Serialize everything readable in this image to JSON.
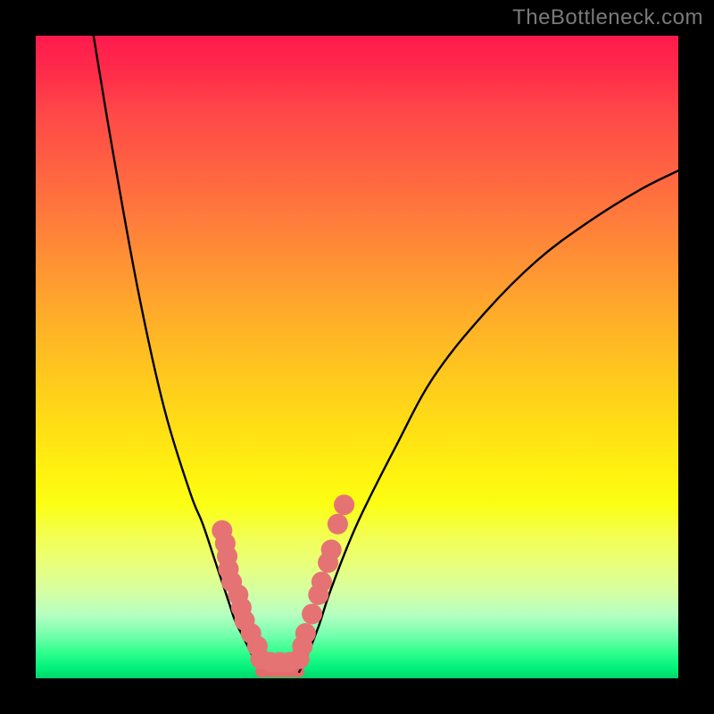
{
  "watermark": "TheBottleneck.com",
  "chart_data": {
    "type": "line",
    "title": "",
    "xlabel": "",
    "ylabel": "",
    "xlim": [
      0,
      100
    ],
    "ylim": [
      0,
      100
    ],
    "legend": false,
    "grid": false,
    "background_gradient": {
      "top": "#ff1a4d",
      "mid": "#ffe016",
      "bottom": "#00d46b"
    },
    "series": [
      {
        "name": "curve-left",
        "color": "#000000",
        "x": [
          9,
          12,
          16,
          20,
          24,
          26,
          28,
          30,
          31,
          32,
          33,
          34,
          35,
          36
        ],
        "values": [
          100,
          82,
          60,
          42,
          29,
          24,
          18,
          12,
          9,
          7,
          5,
          3,
          2,
          1
        ]
      },
      {
        "name": "curve-bottom",
        "color": "#e56a6a",
        "x": [
          35,
          36,
          37,
          38,
          39,
          40,
          41
        ],
        "values": [
          1,
          1,
          1,
          1,
          1,
          1,
          1
        ]
      },
      {
        "name": "curve-right",
        "color": "#000000",
        "x": [
          41,
          42,
          44,
          46,
          50,
          56,
          62,
          70,
          78,
          86,
          94,
          100
        ],
        "values": [
          1,
          3,
          8,
          14,
          24,
          36,
          47,
          57,
          65,
          71,
          76,
          79
        ]
      }
    ],
    "markers": {
      "color": "#e57373",
      "radius": 1.6,
      "points": [
        {
          "x": 29.0,
          "y": 77
        },
        {
          "x": 29.5,
          "y": 79
        },
        {
          "x": 29.8,
          "y": 81
        },
        {
          "x": 30.0,
          "y": 83
        },
        {
          "x": 30.5,
          "y": 85
        },
        {
          "x": 31.5,
          "y": 87
        },
        {
          "x": 32.0,
          "y": 89
        },
        {
          "x": 32.5,
          "y": 91
        },
        {
          "x": 33.5,
          "y": 93
        },
        {
          "x": 34.5,
          "y": 95
        },
        {
          "x": 35.0,
          "y": 97
        },
        {
          "x": 36.5,
          "y": 97.5
        },
        {
          "x": 38.0,
          "y": 97.5
        },
        {
          "x": 39.5,
          "y": 97.5
        },
        {
          "x": 41.0,
          "y": 97.0
        },
        {
          "x": 41.5,
          "y": 95
        },
        {
          "x": 42.0,
          "y": 93
        },
        {
          "x": 43.0,
          "y": 90
        },
        {
          "x": 44.0,
          "y": 87
        },
        {
          "x": 44.5,
          "y": 85
        },
        {
          "x": 45.5,
          "y": 82
        },
        {
          "x": 46.0,
          "y": 80
        },
        {
          "x": 47.0,
          "y": 76
        },
        {
          "x": 48.0,
          "y": 73
        }
      ]
    }
  }
}
